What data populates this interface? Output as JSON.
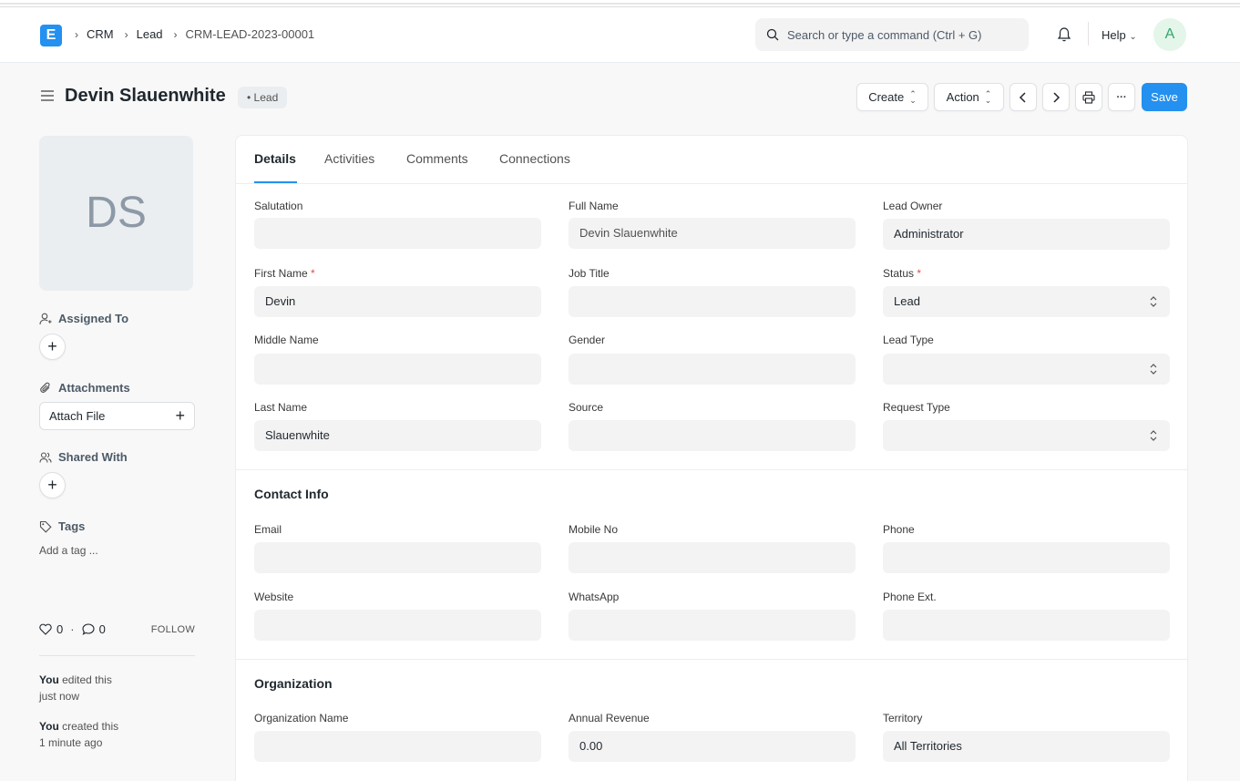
{
  "nav": {
    "logo_letter": "E",
    "breadcrumbs": [
      "CRM",
      "Lead",
      "CRM-LEAD-2023-00001"
    ],
    "search_placeholder": "Search or type a command (Ctrl + G)",
    "help_label": "Help",
    "avatar_letter": "A"
  },
  "header": {
    "title": "Devin Slauenwhite",
    "status_badge": "Lead",
    "create_label": "Create",
    "action_label": "Action",
    "more_label": "···",
    "save_label": "Save"
  },
  "sidebar": {
    "avatar_initials": "DS",
    "assigned_to_label": "Assigned To",
    "attachments_label": "Attachments",
    "attach_file_label": "Attach File",
    "shared_with_label": "Shared With",
    "tags_label": "Tags",
    "add_tag_label": "Add a tag ...",
    "likes_count": "0",
    "comments_count": "0",
    "follow_label": "FOLLOW",
    "activity": [
      {
        "actor": "You",
        "action": " edited this",
        "time": "just now"
      },
      {
        "actor": "You",
        "action": " created this",
        "time": "1 minute ago"
      }
    ]
  },
  "tabs": [
    "Details",
    "Activities",
    "Comments",
    "Connections"
  ],
  "fields": {
    "salutation": {
      "label": "Salutation",
      "value": ""
    },
    "full_name": {
      "label": "Full Name",
      "value": "Devin Slauenwhite"
    },
    "lead_owner": {
      "label": "Lead Owner",
      "value": "Administrator"
    },
    "first_name": {
      "label": "First Name",
      "value": "Devin"
    },
    "job_title": {
      "label": "Job Title",
      "value": ""
    },
    "status": {
      "label": "Status",
      "value": "Lead"
    },
    "middle_name": {
      "label": "Middle Name",
      "value": ""
    },
    "gender": {
      "label": "Gender",
      "value": ""
    },
    "lead_type": {
      "label": "Lead Type",
      "value": ""
    },
    "last_name": {
      "label": "Last Name",
      "value": "Slauenwhite"
    },
    "source": {
      "label": "Source",
      "value": ""
    },
    "request_type": {
      "label": "Request Type",
      "value": ""
    },
    "email": {
      "label": "Email",
      "value": ""
    },
    "mobile_no": {
      "label": "Mobile No",
      "value": ""
    },
    "phone": {
      "label": "Phone",
      "value": ""
    },
    "website": {
      "label": "Website",
      "value": ""
    },
    "whatsapp": {
      "label": "WhatsApp",
      "value": ""
    },
    "phone_ext": {
      "label": "Phone Ext.",
      "value": ""
    },
    "organization_name": {
      "label": "Organization Name",
      "value": ""
    },
    "annual_revenue": {
      "label": "Annual Revenue",
      "value": "0.00"
    },
    "territory": {
      "label": "Territory",
      "value": "All Territories"
    }
  },
  "sections": {
    "contact_info": "Contact Info",
    "organization": "Organization"
  },
  "required_mark": "*",
  "colors": {
    "primary": "#2490ef",
    "required": "#e24c4c",
    "avatar_green": "#30a66d"
  }
}
